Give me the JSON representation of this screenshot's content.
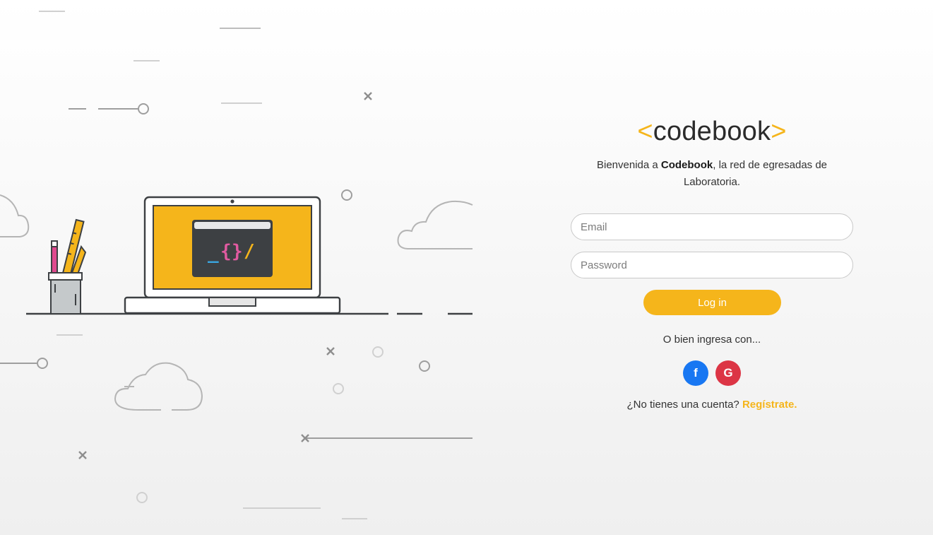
{
  "logo": {
    "left_bracket": "<",
    "name": "codebook",
    "right_bracket": ">"
  },
  "welcome": {
    "prefix": "Bienvenida a ",
    "brand": "Codebook",
    "suffix": ", la red de egresadas de Laboratoria."
  },
  "form": {
    "email_placeholder": "Email",
    "password_placeholder": "Password",
    "login_label": "Log in"
  },
  "alternative": {
    "text": "O bien ingresa con...",
    "facebook_glyph": "f",
    "google_glyph": "G"
  },
  "signup": {
    "question": "¿No tienes una cuenta?",
    "link_label": "Regístrate."
  },
  "illustration": {
    "code_symbols": [
      "_",
      "{",
      "}",
      "/"
    ]
  },
  "colors": {
    "accent": "#f5b51b",
    "facebook": "#1877f2",
    "google": "#dc3545",
    "dark": "#3d4043"
  }
}
